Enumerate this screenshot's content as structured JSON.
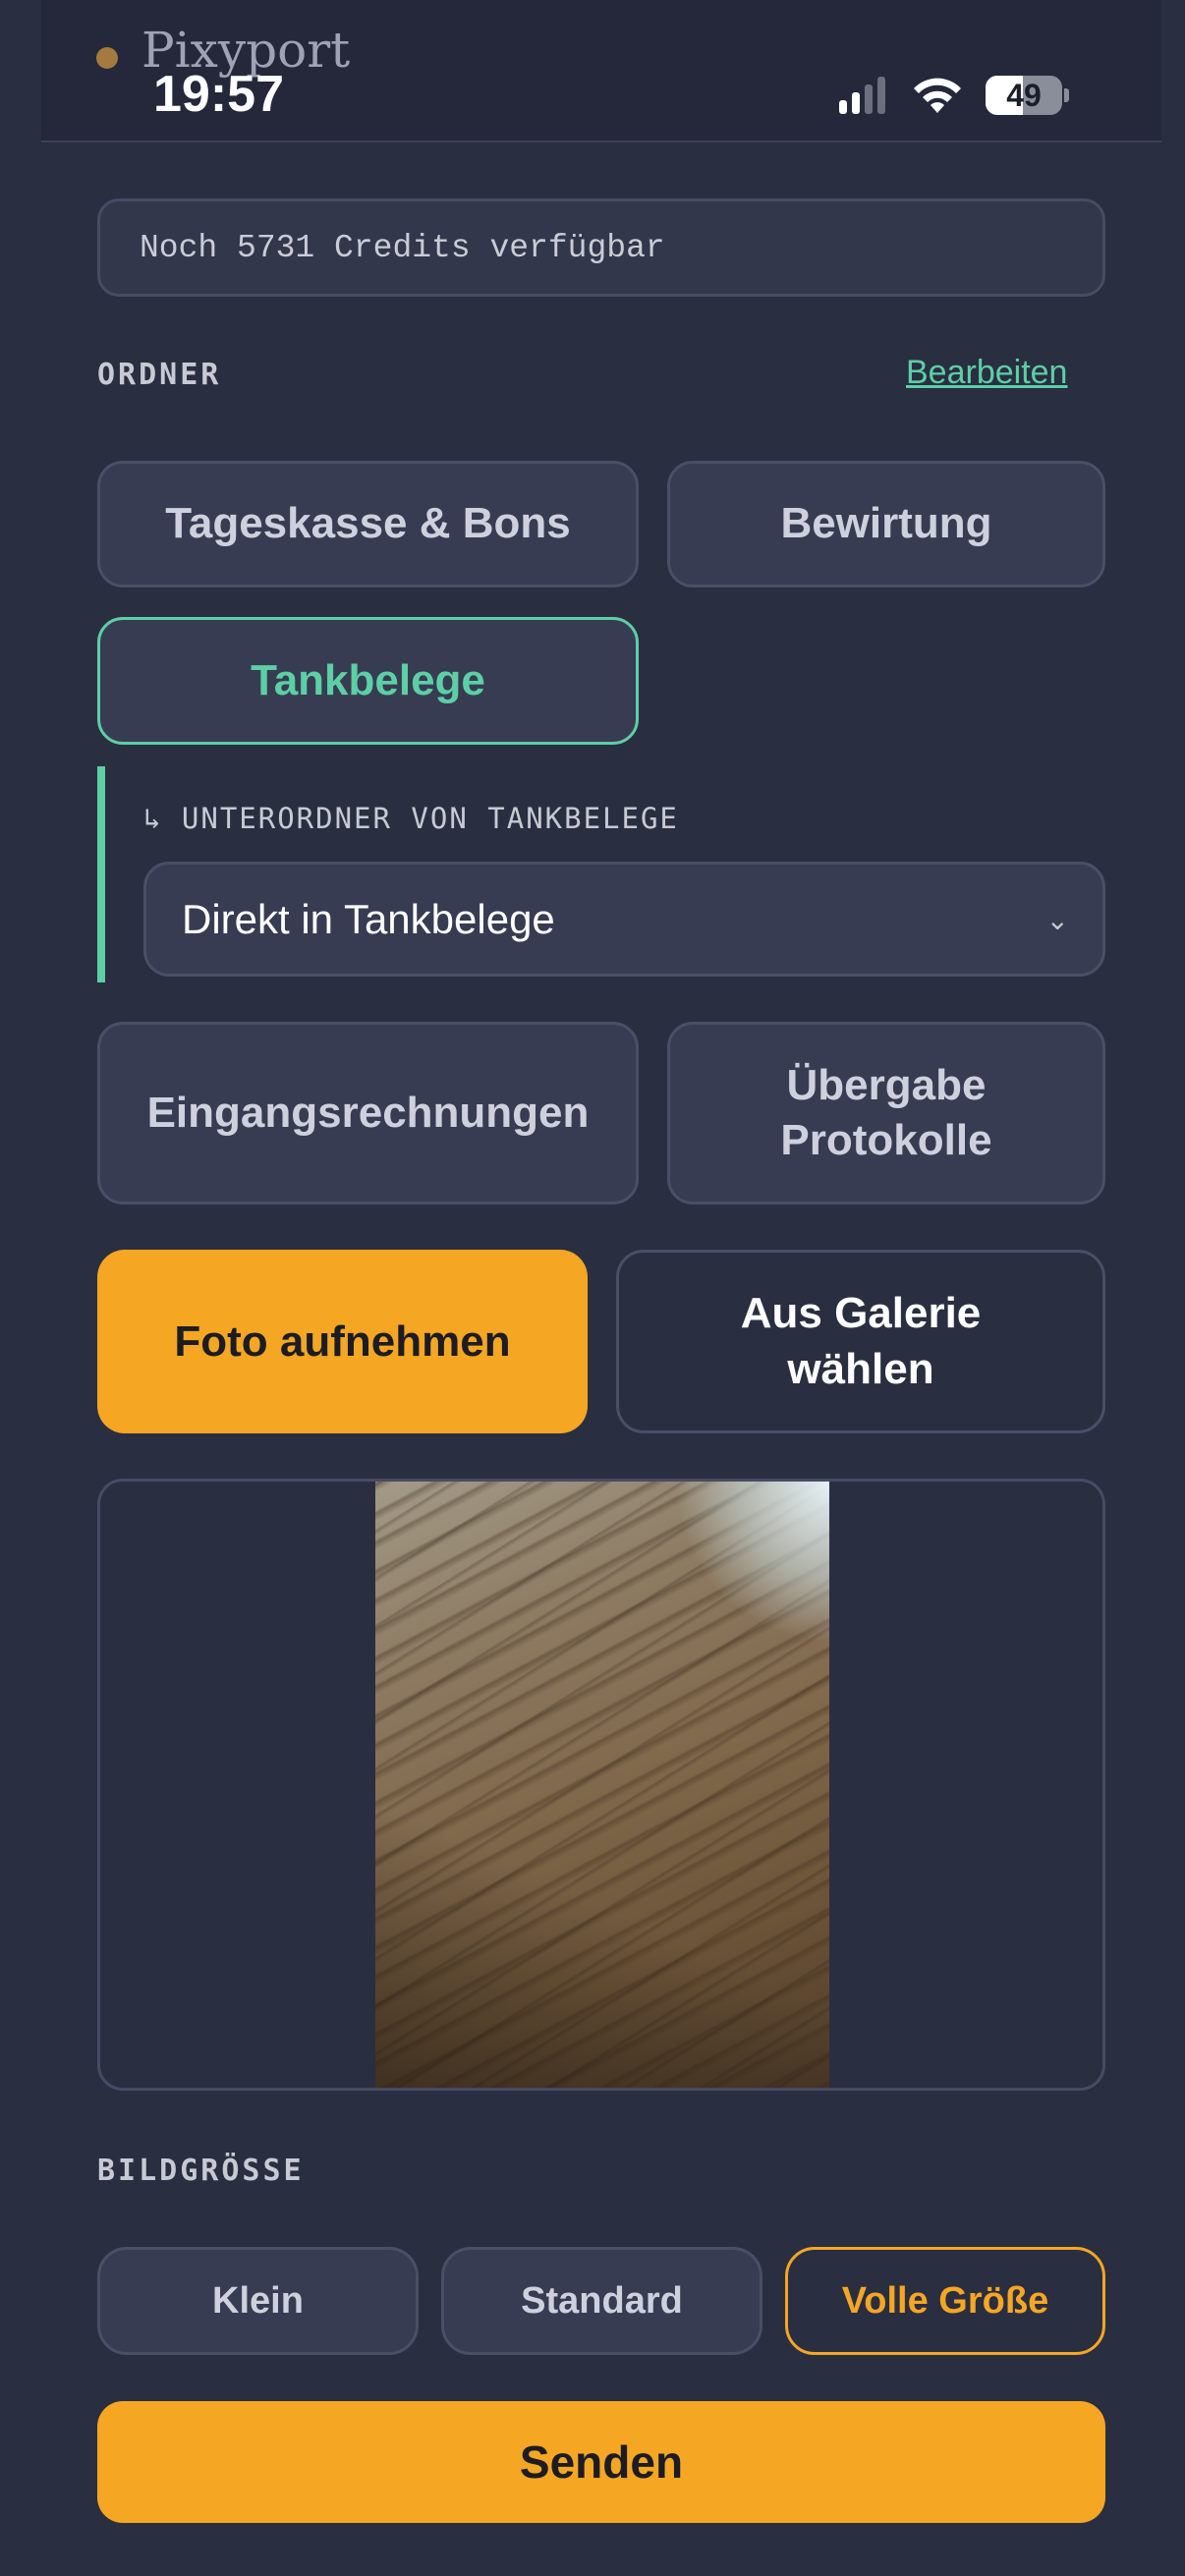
{
  "app": {
    "title": "Pixyport",
    "brand_color": "#a47a3f"
  },
  "status_bar": {
    "time": "19:57",
    "battery": "49",
    "battery_level": 0.49,
    "signal_bars": 2,
    "wifi": "wifi-icon"
  },
  "credits": {
    "text": "Noch 5731 Credits verfügbar"
  },
  "folders_section": {
    "label": "ORDNER",
    "edit_label": "Bearbeiten",
    "items": [
      {
        "label": "Tageskasse & Bons",
        "active": false
      },
      {
        "label": "Bewirtung",
        "active": false
      },
      {
        "label": "Tankbelege",
        "active": true
      },
      {
        "label": "Eingangsrechnungen",
        "active": false
      },
      {
        "label": "Übergabe Protokolle",
        "active": false
      }
    ]
  },
  "subfolder": {
    "label": "↳ UNTERORDNER VON TANKBELEGE",
    "selected": "Direkt in Tankbelege",
    "chevron": "⌄"
  },
  "actions": {
    "take_photo": "Foto aufnehmen",
    "from_gallery": "Aus Galerie wählen"
  },
  "image_size": {
    "label": "BILDGRÖSSE",
    "options": [
      "Klein",
      "Standard",
      "Volle Größe"
    ],
    "selected": "Volle Größe"
  },
  "send_label": "Senden",
  "colors": {
    "accent": "#f5a623",
    "active_folder": "#5ccfa5",
    "background": "#2a2e41"
  }
}
